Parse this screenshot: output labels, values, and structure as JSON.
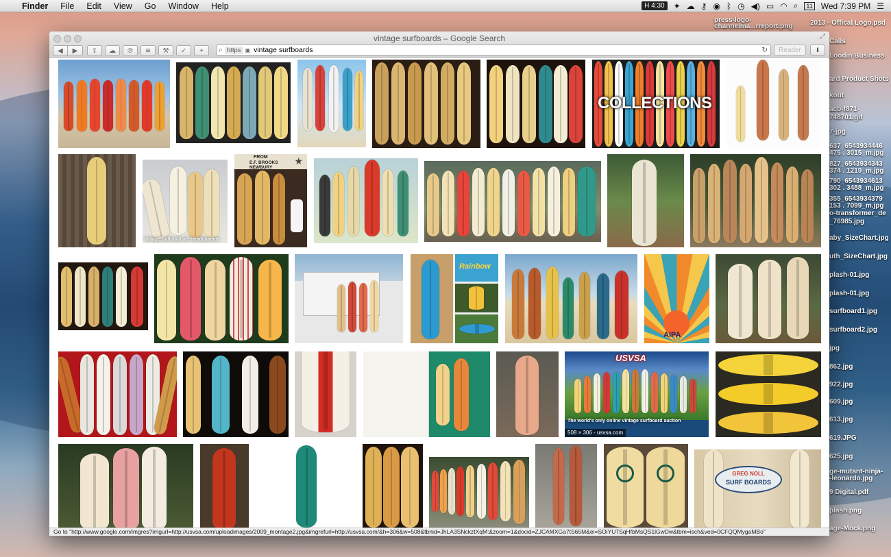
{
  "menubar": {
    "apple": "",
    "app": "Finder",
    "items": [
      "File",
      "Edit",
      "View",
      "Go",
      "Window",
      "Help"
    ],
    "timer": "4:30",
    "cal_day": "11",
    "clock": "Wed 7:39 PM"
  },
  "desktop_files": [
    "press-logo-",
    "channelma...rreport.png",
    "2013 - Offical Logo.psd",
    "Calls",
    "Loodin Business",
    "ard Product Shots",
    "kout",
    "acb-f871-",
    "748701.gif",
    "7-jpg",
    "637_6543934446",
    "475 . 3015_m.jpg",
    "827_6543934343",
    "374 . 1219_m.jpg",
    "790_6543934613",
    "302 . 3488_m.jpg",
    "355_6543934379",
    "153 . 7099_m.jpg",
    "o-transformer_de",
    "_76985.jpg",
    "aby_SizeChart.jpg",
    "uth_SizeChart.jpg",
    "plash-01.jpg",
    "plash-01.jpg",
    "surfboard1.jpg",
    "surfboard2.jpg",
    "jpg",
    "862.jpg",
    "922.jpg",
    "609.jpg",
    "613.jpg",
    "619.JPG",
    "625.jpg",
    "ge-mutant-ninja-",
    "-leonardo.jpg",
    "9 Digital.pdf",
    "plash.png",
    "age-Mock.png"
  ],
  "window": {
    "title": "vintage surfboards – Google Search",
    "scheme": "https",
    "url": "vintage surfboards",
    "reader": "Reader",
    "reload_icon": "↻",
    "status": "Go to \"http://www.google.com/imgres?imgurl=http://usvsa.com/uploadimages/2009_montage2.jpg&imgrefurl=http://usvsa.com/&h=306&w=508&tbnid=JhLA3SNckztXqM:&zoom=1&docid=ZJCAMXGa7tS65M&ei=SOiYU7SqHfbMsQS1lGwDw&tbm=isch&ved=0CFQQMygaMBo\""
  },
  "results": {
    "collections_label": "COLLECTIONS",
    "tile_caption": "VintageSurfboard.net Headquarters",
    "usvsa_logo": "USVSA",
    "usvsa_tagline": "The world's only online vintage surfboard auction",
    "usvsa_hover": "508 × 306 - usvsa.com",
    "sign_from": "FROM",
    "sign_place": "E.F. BROOKS NEWBURY",
    "aipa_logo": "AIPA",
    "rainbow_logo": "Rainbow",
    "surf_shop_name": "GREG NOLL",
    "surf_shop_sign": "SURF BOARDS"
  },
  "colors": {
    "accent": "#4a90d9",
    "window_bg": "#ffffff",
    "toolbar": "#d6d6d6"
  }
}
